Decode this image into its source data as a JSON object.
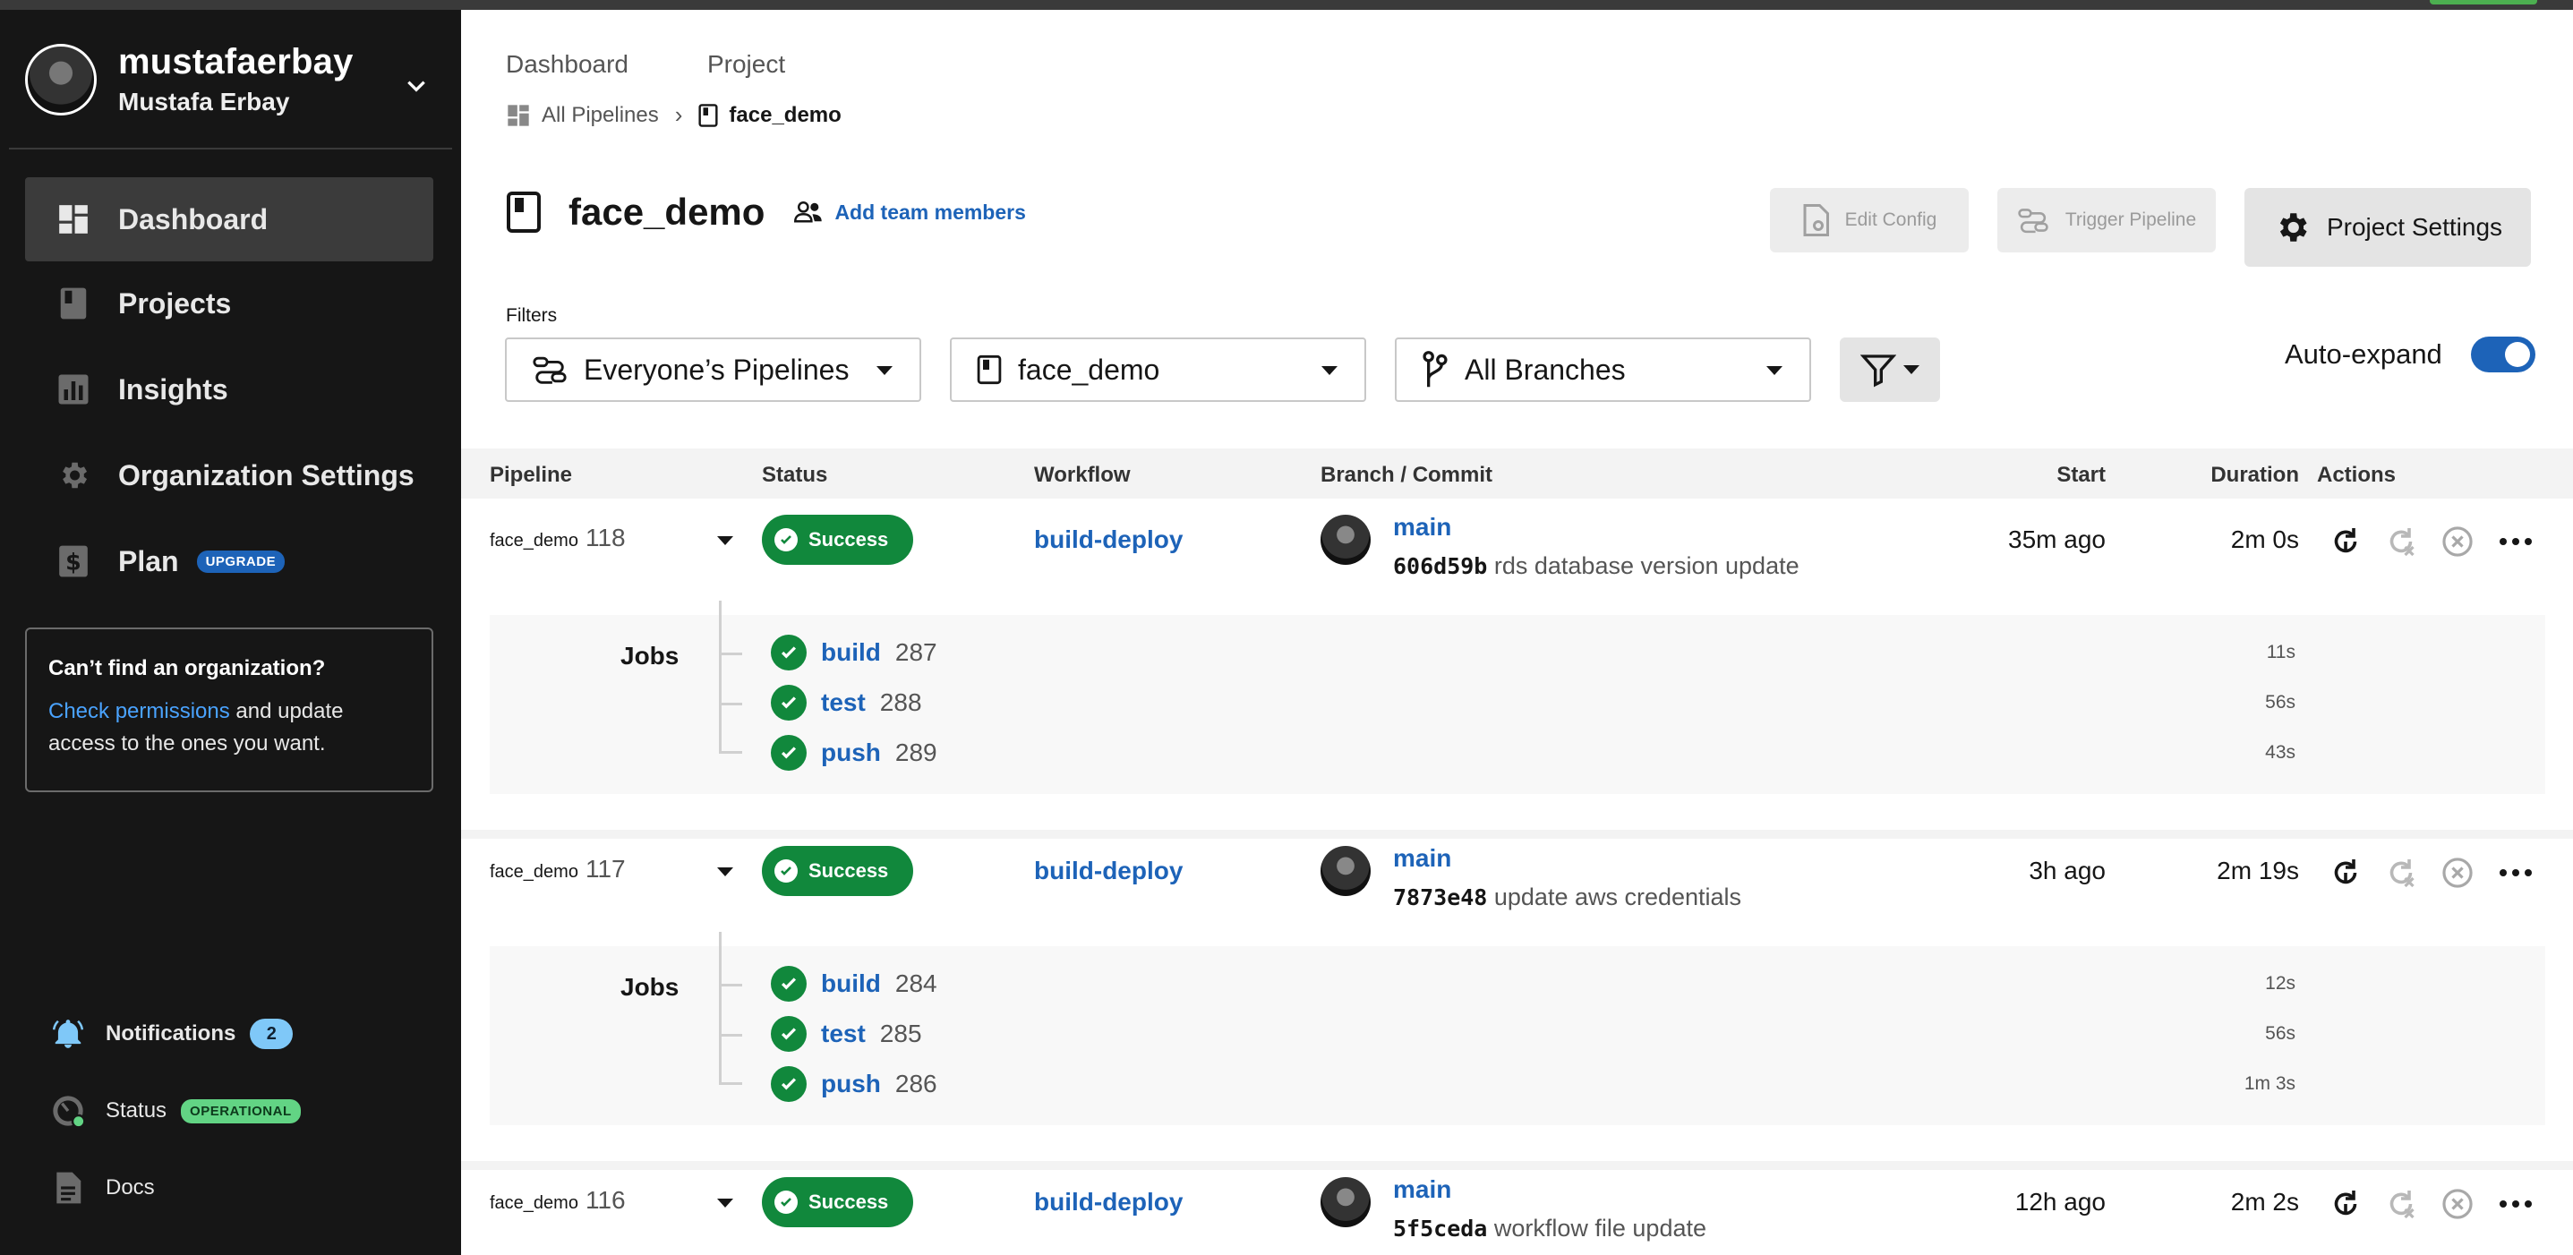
{
  "user": {
    "username": "mustafaerbay",
    "full_name": "Mustafa Erbay"
  },
  "sidebar": {
    "items": [
      {
        "label": "Dashboard",
        "icon": "dashboard-icon",
        "active": true
      },
      {
        "label": "Projects",
        "icon": "book-icon"
      },
      {
        "label": "Insights",
        "icon": "chart-icon"
      },
      {
        "label": "Organization Settings",
        "icon": "gear-icon"
      },
      {
        "label": "Plan",
        "icon": "dollar-icon",
        "badge": "UPGRADE"
      }
    ],
    "org_box": {
      "title": "Can’t find an organization?",
      "link": "Check permissions",
      "text": " and update access to the ones you want."
    },
    "footer": {
      "notifications": {
        "label": "Notifications",
        "count": "2"
      },
      "status": {
        "label": "Status",
        "badge": "OPERATIONAL"
      },
      "docs": {
        "label": "Docs"
      }
    }
  },
  "header": {
    "crumb_top": [
      "Dashboard",
      "Project"
    ],
    "breadcrumb": {
      "all": "All Pipelines",
      "current": "face_demo"
    },
    "title": "face_demo",
    "add_team": "Add team members",
    "buttons": {
      "edit_config": "Edit Config",
      "trigger_pipeline": "Trigger Pipeline",
      "project_settings": "Project Settings"
    }
  },
  "filters": {
    "label": "Filters",
    "pipelines": "Everyone’s Pipelines",
    "project": "face_demo",
    "branches": "All Branches",
    "auto_expand": "Auto-expand"
  },
  "table": {
    "headers": {
      "pipeline": "Pipeline",
      "status": "Status",
      "workflow": "Workflow",
      "branch_commit": "Branch / Commit",
      "start": "Start",
      "duration": "Duration",
      "actions": "Actions"
    },
    "jobs_label": "Jobs",
    "rows": [
      {
        "project": "face_demo",
        "number": "118",
        "status": "Success",
        "workflow": "build-deploy",
        "branch": "main",
        "sha": "606d59b",
        "message": "rds database version update",
        "start": "35m ago",
        "duration": "2m 0s",
        "jobs": [
          {
            "name": "build",
            "num": "287",
            "duration": "11s"
          },
          {
            "name": "test",
            "num": "288",
            "duration": "56s"
          },
          {
            "name": "push",
            "num": "289",
            "duration": "43s"
          }
        ]
      },
      {
        "project": "face_demo",
        "number": "117",
        "status": "Success",
        "workflow": "build-deploy",
        "branch": "main",
        "sha": "7873e48",
        "message": "update aws credentials",
        "start": "3h ago",
        "duration": "2m 19s",
        "jobs": [
          {
            "name": "build",
            "num": "284",
            "duration": "12s"
          },
          {
            "name": "test",
            "num": "285",
            "duration": "56s"
          },
          {
            "name": "push",
            "num": "286",
            "duration": "1m 3s"
          }
        ]
      },
      {
        "project": "face_demo",
        "number": "116",
        "status": "Success",
        "workflow": "build-deploy",
        "branch": "main",
        "sha": "5f5ceda",
        "message": "workflow file update",
        "start": "12h ago",
        "duration": "2m 2s"
      }
    ]
  }
}
